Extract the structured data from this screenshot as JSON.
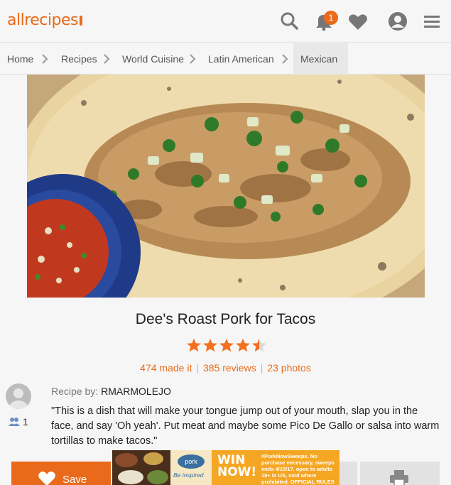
{
  "header": {
    "logo": "allrecipes",
    "notification_count": "1"
  },
  "breadcrumb": {
    "items": [
      "Home",
      "Recipes",
      "World Cuisine",
      "Latin American",
      "Mexican"
    ]
  },
  "recipe": {
    "title": "Dee's Roast Pork for Tacos",
    "rating": 4.5,
    "made_it": "474 made it",
    "reviews": "385 reviews",
    "photos": "23 photos",
    "recipe_by_label": "Recipe by:",
    "author": "RMARMOLEJO",
    "followers": "1",
    "description": "\"This is a dish that will make your tongue jump out of your mouth, slap you in the face, and say 'Oh yeah'. Put meat and maybe some Pico De Gallo or salsa into warm tortillas to make tacos.\""
  },
  "actions": {
    "save_label": "Save"
  },
  "ad": {
    "brand": "pork",
    "tagline": "Be inspired",
    "headline_1": "WIN",
    "headline_2": "NOW!",
    "fine_print": "#PorkNowSweeps. No purchase necessary, sweeps ends 4/15/17, open to adults 18+ in US, void where prohibited. OFFICIAL RULES"
  },
  "colors": {
    "accent": "#e96a1a",
    "star": "#f37021",
    "background": "#f6f6f6"
  }
}
